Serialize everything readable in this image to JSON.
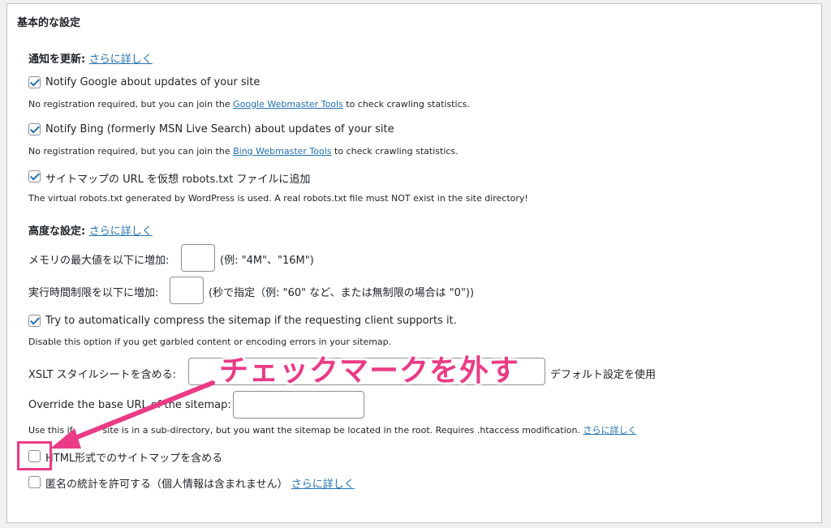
{
  "panel": {
    "title": "基本的な設定"
  },
  "notify_section": {
    "heading": "通知を更新:",
    "more_link": "さらに詳しく"
  },
  "notify_google": {
    "checked": true,
    "label": "Notify Google about updates of your site",
    "desc_before": "No registration required, but you can join the",
    "desc_link": "Google Webmaster Tools",
    "desc_after": "to check crawling statistics."
  },
  "notify_bing": {
    "checked": true,
    "label": "Notify Bing (formerly MSN Live Search) about updates of your site",
    "desc_before": "No registration required, but you can join the",
    "desc_link": "Bing Webmaster Tools",
    "desc_after": "to check crawling statistics."
  },
  "robots": {
    "checked": true,
    "label": "サイトマップの URL を仮想 robots.txt ファイルに追加",
    "desc": "The virtual robots.txt generated by WordPress is used. A real robots.txt file must NOT exist in the site directory!"
  },
  "advanced_section": {
    "heading": "高度な設定:",
    "more_link": "さらに詳しく"
  },
  "memory": {
    "label": "メモリの最大値を以下に増加:",
    "value": "",
    "hint": "(例: \"4M\"、\"16M\")"
  },
  "exec_time": {
    "label": "実行時間制限を以下に増加:",
    "value": "",
    "hint": "(秒で指定（例: \"60\" など、または無制限の場合は \"0\"))"
  },
  "compress": {
    "checked": true,
    "label": "Try to automatically compress the sitemap if the requesting client supports it.",
    "desc": "Disable this option if you get garbled content or encoding errors in your sitemap."
  },
  "xslt": {
    "label": "XSLT スタイルシートを含める:",
    "value": "",
    "trailing": "デフォルト設定を使用"
  },
  "base_url": {
    "label": "Override the base URL of the sitemap:",
    "value": "",
    "desc_a": "Use this if",
    "desc_b": "site is in a sub-directory, but you want the sitemap be located in the root. Requires .htaccess modification.",
    "more_link": "さらに詳しく"
  },
  "html_sitemap": {
    "checked": false,
    "label": "HTML形式でのサイトマップを含める"
  },
  "anon_stats": {
    "checked": false,
    "label": "匿名の統計を許可する（個人情報は含まれません）",
    "more_link": "さらに詳しく"
  },
  "annotation": {
    "text": "チェックマークを外す",
    "color": "#ea3b86"
  }
}
